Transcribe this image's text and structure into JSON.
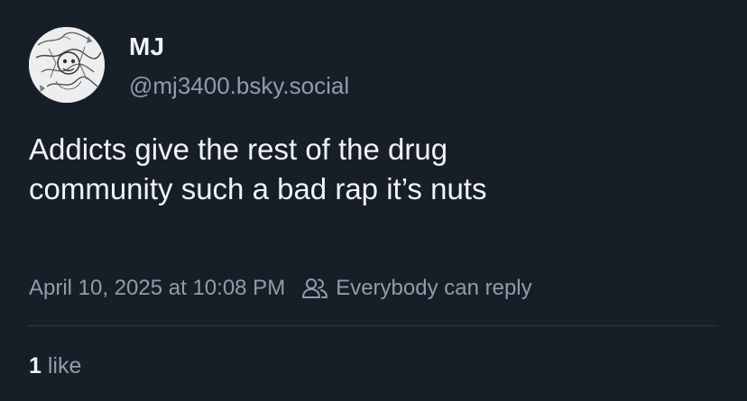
{
  "post": {
    "author": {
      "display_name": "MJ",
      "handle": "@mj3400.bsky.social",
      "avatar_icon": "avatar-sketch-illustration"
    },
    "text_line1": "Addicts give the rest of the drug",
    "text_line2": "community such a bad rap it’s nuts",
    "timestamp": "April 10, 2025 at 10:08 PM",
    "reply_setting": "Everybody can reply",
    "reply_icon": "people-icon",
    "likes": {
      "count": "1",
      "label": "like"
    }
  },
  "colors": {
    "background": "#161e27",
    "text_primary": "#f1f3f5",
    "text_secondary": "#8f9dab",
    "divider": "#2e3a47"
  }
}
